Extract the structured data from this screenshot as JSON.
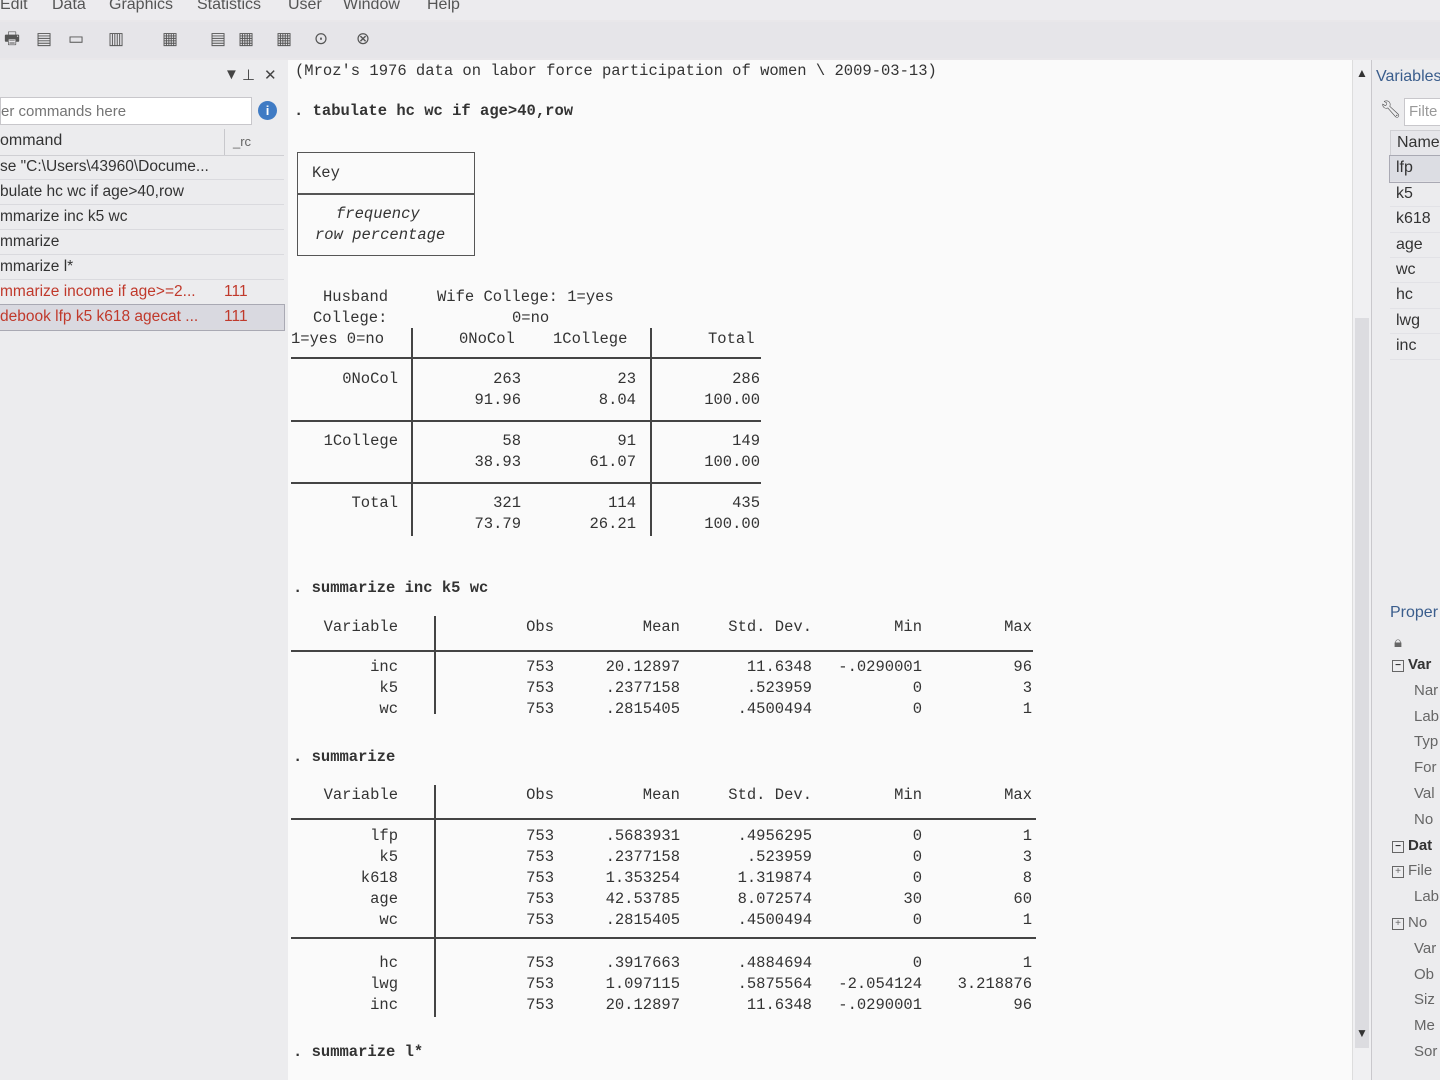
{
  "menu": [
    "Edit",
    "Data",
    "Graphics",
    "Statistics",
    "User",
    "Window",
    "Help"
  ],
  "toolbar_icons": [
    "print-icon",
    "log-icon",
    "viewer-icon",
    "graph-icon",
    "do-file-icon",
    "data-editor-icon",
    "data-browser-icon",
    "variables-manager-icon",
    "more-icon",
    "break-icon"
  ],
  "left": {
    "search_placeholder": "er commands here",
    "header_command": "ommand",
    "header_rc": "_rc",
    "history": [
      {
        "cmd": "se \"C:\\Users\\43960\\Docume...",
        "rc": "",
        "err": false
      },
      {
        "cmd": "bulate hc wc if age>40,row",
        "rc": "",
        "err": false
      },
      {
        "cmd": "mmarize inc k5 wc",
        "rc": "",
        "err": false
      },
      {
        "cmd": "mmarize",
        "rc": "",
        "err": false
      },
      {
        "cmd": "mmarize l*",
        "rc": "",
        "err": false
      },
      {
        "cmd": "mmarize income if age>=2...",
        "rc": "111",
        "err": true
      },
      {
        "cmd": "debook lfp k5 k618 agecat ...",
        "rc": "111",
        "err": true
      }
    ]
  },
  "results": {
    "header": "(Mroz's 1976 data on labor force participation of women \\ 2009-03-13)",
    "cmd1": ". tabulate hc wc if age>40,row",
    "key_title": "Key",
    "key_line1": "frequency",
    "key_line2": "row percentage",
    "tab_row_title": [
      "Husband",
      "College:",
      "1=yes 0=no"
    ],
    "tab_col_title": [
      "Wife College: 1=yes",
      "0=no"
    ],
    "tab_cols": [
      "0NoCol",
      "1College",
      "Total"
    ],
    "tab_rows": [
      {
        "label": "0NoCol",
        "f": [
          "263",
          "23",
          "286"
        ],
        "p": [
          "91.96",
          "8.04",
          "100.00"
        ]
      },
      {
        "label": "1College",
        "f": [
          "58",
          "91",
          "149"
        ],
        "p": [
          "38.93",
          "61.07",
          "100.00"
        ]
      },
      {
        "label": "Total",
        "f": [
          "321",
          "114",
          "435"
        ],
        "p": [
          "73.79",
          "26.21",
          "100.00"
        ]
      }
    ],
    "cmd2": ". summarize inc k5 wc",
    "sum_headers": [
      "Variable",
      "Obs",
      "Mean",
      "Std. Dev.",
      "Min",
      "Max"
    ],
    "sum1": [
      [
        "inc",
        "753",
        "20.12897",
        "11.6348",
        "-.0290001",
        "96"
      ],
      [
        "k5",
        "753",
        ".2377158",
        ".523959",
        "0",
        "3"
      ],
      [
        "wc",
        "753",
        ".2815405",
        ".4500494",
        "0",
        "1"
      ]
    ],
    "cmd3": ". summarize",
    "sum2a": [
      [
        "lfp",
        "753",
        ".5683931",
        ".4956295",
        "0",
        "1"
      ],
      [
        "k5",
        "753",
        ".2377158",
        ".523959",
        "0",
        "3"
      ],
      [
        "k618",
        "753",
        "1.353254",
        "1.319874",
        "0",
        "8"
      ],
      [
        "age",
        "753",
        "42.53785",
        "8.072574",
        "30",
        "60"
      ],
      [
        "wc",
        "753",
        ".2815405",
        ".4500494",
        "0",
        "1"
      ]
    ],
    "sum2b": [
      [
        "hc",
        "753",
        ".3917663",
        ".4884694",
        "0",
        "1"
      ],
      [
        "lwg",
        "753",
        "1.097115",
        ".5875564",
        "-2.054124",
        "3.218876"
      ],
      [
        "inc",
        "753",
        "20.12897",
        "11.6348",
        "-.0290001",
        "96"
      ]
    ],
    "cmd4": ". summarize l*"
  },
  "right": {
    "variables_title": "Variables",
    "filter_placeholder": "Filte",
    "name_header": "Name",
    "vars": [
      "lfp",
      "k5",
      "k618",
      "age",
      "wc",
      "hc",
      "lwg",
      "inc"
    ],
    "properties_title": "Proper",
    "prop_sections": [
      "Var",
      "Nar",
      "Lab",
      "Typ",
      "For",
      "Val",
      "No",
      "Dat",
      "File",
      "Lab",
      "No",
      "Var",
      "Ob",
      "Siz",
      "Me",
      "Sor"
    ]
  }
}
